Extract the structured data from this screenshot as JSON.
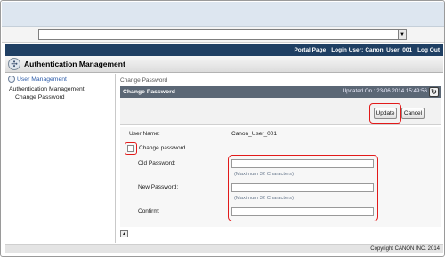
{
  "nav": {
    "portal_page": "Portal Page",
    "login_user_label": "Login User:",
    "login_user_name": "Canon_User_001",
    "logout": "Log Out"
  },
  "app": {
    "title": "Authentication Management"
  },
  "sidebar": {
    "header": "User Management",
    "section": "Authentication Management",
    "item": "Change Password"
  },
  "main": {
    "breadcrumb": "Change Password",
    "panel_title": "Change Password",
    "updated": "Updated On : 23/06 2014 15:49:56",
    "update_button": "Update",
    "cancel_button": "Cancel",
    "user_name_label": "User Name:",
    "user_name_value": "Canon_User_001",
    "change_password_label": "Change password",
    "old_password_label": "Old Password:",
    "new_password_label": "New Password:",
    "confirm_label": "Confirm:",
    "old_hint": "(Maximum 32 Characters)",
    "new_hint": "(Maximum 32 Characters)"
  },
  "footer": {
    "copyright": "Copyright CANON INC. 2014"
  },
  "colors": {
    "nav_bg": "#1f3f63",
    "panel_head_bg": "#5b6775",
    "highlight": "#e21a1a"
  }
}
